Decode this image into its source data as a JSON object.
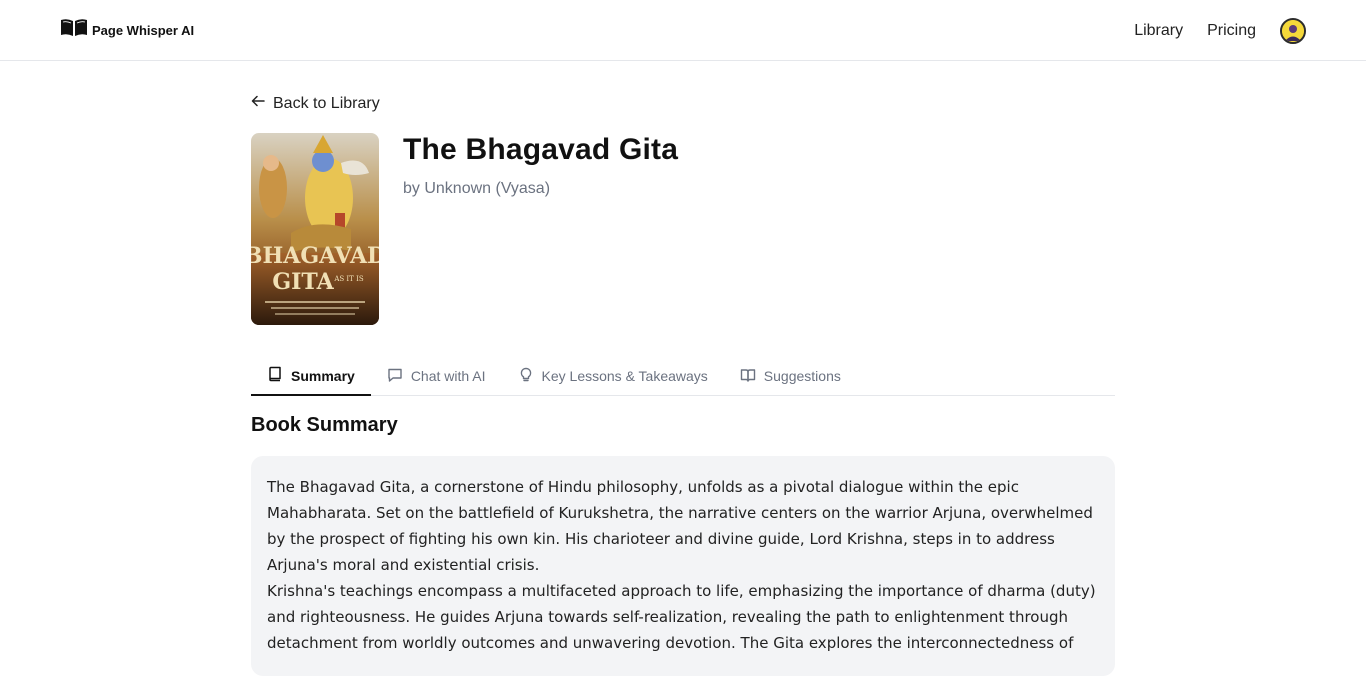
{
  "header": {
    "brand_name": "Page Whisper AI",
    "nav": [
      {
        "label": "Library"
      },
      {
        "label": "Pricing"
      }
    ]
  },
  "book": {
    "back_label": "Back to Library",
    "title": "The Bhagavad Gita",
    "author": "by Unknown (Vyasa)",
    "cover": {
      "title_line1": "BHAGAVAD",
      "title_line2": "GITA",
      "subtitle": "AS IT IS"
    }
  },
  "tabs": [
    {
      "label": "Summary",
      "icon": "book-icon",
      "active": true
    },
    {
      "label": "Chat with AI",
      "icon": "chat-icon",
      "active": false
    },
    {
      "label": "Key Lessons & Takeaways",
      "icon": "lightbulb-icon",
      "active": false
    },
    {
      "label": "Suggestions",
      "icon": "open-book-icon",
      "active": false
    }
  ],
  "summary": {
    "heading": "Book Summary",
    "paragraphs": [
      "The Bhagavad Gita, a cornerstone of Hindu philosophy, unfolds as a pivotal dialogue within the epic Mahabharata. Set on the battlefield of Kurukshetra, the narrative centers on the warrior Arjuna, overwhelmed by the prospect of fighting his own kin. His charioteer and divine guide, Lord Krishna, steps in to address Arjuna's moral and existential crisis.",
      "Krishna's teachings encompass a multifaceted approach to life, emphasizing the importance of dharma (duty) and righteousness. He guides Arjuna towards self-realization, revealing the path to enlightenment through detachment from worldly outcomes and unwavering devotion. The Gita explores the interconnectedness of"
    ]
  },
  "colors": {
    "accent": "#111111",
    "muted_text": "#6b7280",
    "summary_bg": "#f3f4f6",
    "avatar_bg": "#f5d83a"
  }
}
